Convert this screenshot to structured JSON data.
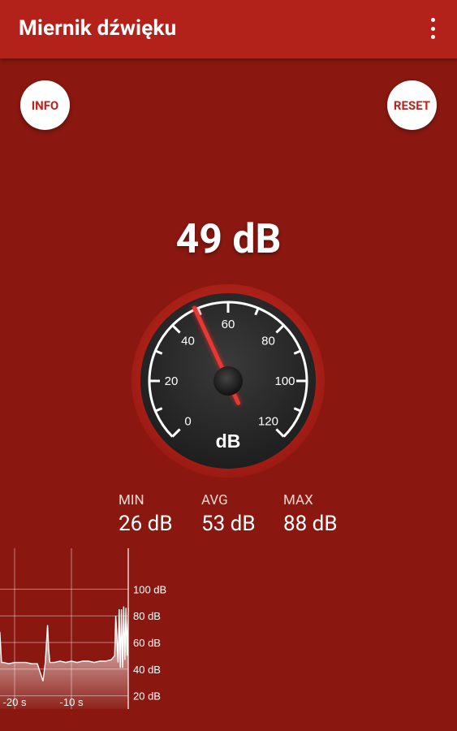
{
  "app": {
    "title": "Miernik dźwięku",
    "menu_icon": "more-vert-icon"
  },
  "buttons": {
    "info": "INFO",
    "reset": "RESET"
  },
  "reading": {
    "value": "49 dB",
    "db": 49
  },
  "gauge": {
    "unit": "dB",
    "scale_labels": [
      "0",
      "20",
      "40",
      "60",
      "80",
      "100",
      "120"
    ],
    "needle_value_db": 49,
    "min_db": 0,
    "max_db": 120,
    "needle_color": "#e53935",
    "rim_color": "#c8251c"
  },
  "stats": {
    "min": {
      "label": "MIN",
      "value": "26 dB"
    },
    "avg": {
      "label": "AVG",
      "value": "53 dB"
    },
    "max": {
      "label": "MAX",
      "value": "88 dB"
    }
  },
  "graph": {
    "y_labels": [
      "100 dB",
      "80 dB",
      "60 dB",
      "40 dB",
      "20 dB"
    ],
    "x_labels": [
      "-20 s",
      "-10 s"
    ],
    "chart_data": {
      "type": "area",
      "x_seconds": [
        -24,
        -23.5,
        -23,
        -22.6,
        -22.3,
        -22,
        -21,
        -20,
        -19,
        -18,
        -17,
        -16,
        -15,
        -14.6,
        -14.2,
        -14,
        -13.8,
        -13.4,
        -13,
        -12,
        -11,
        -10,
        -9,
        -8,
        -7,
        -6,
        -5,
        -4,
        -3,
        -2.4,
        -2.2,
        -2,
        -1.8,
        -1.6,
        -1.4,
        -1.2,
        -1,
        -0.8,
        -0.6,
        -0.4,
        -0.2,
        0
      ],
      "values_db": [
        45,
        46,
        47,
        68,
        45,
        45,
        44,
        45,
        45,
        45,
        44,
        44,
        31,
        45,
        73,
        55,
        45,
        45,
        45,
        46,
        45,
        46,
        45,
        46,
        46,
        45,
        46,
        46,
        47,
        50,
        80,
        65,
        45,
        85,
        41,
        85,
        41,
        87,
        47,
        86,
        50,
        86
      ]
    }
  }
}
